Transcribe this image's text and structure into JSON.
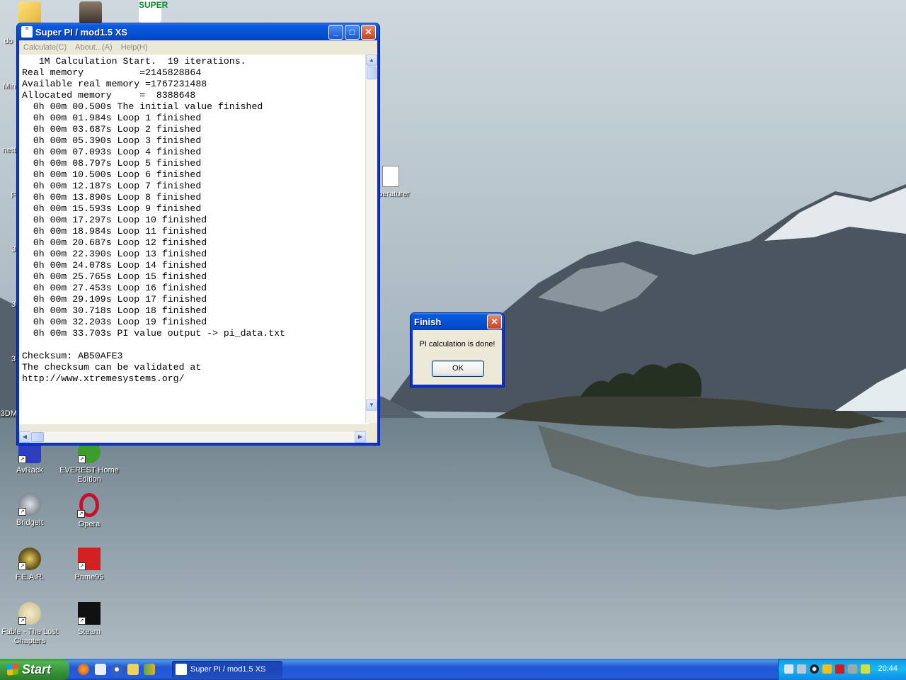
{
  "desktop": {
    "icons": [
      {
        "label": "AvRack",
        "color": "#2b3fbf"
      },
      {
        "label": "EVEREST Home Edition",
        "color": "#3e9c2a"
      },
      {
        "label": "BridgeIt",
        "color": "#5a6270"
      },
      {
        "label": "Opera",
        "color": "#c8102e"
      },
      {
        "label": "F.E.A.R.",
        "color": "#6b5a1e"
      },
      {
        "label": "Prime95",
        "color": "#d42020"
      },
      {
        "label": "Fable - The Lost Chapters",
        "color": "#c7b78a"
      },
      {
        "label": "Steam",
        "color": "#111111"
      },
      {
        "label": "mperaturer",
        "color": "#e8e8e8"
      }
    ],
    "partial_labels": [
      "do",
      "Min",
      "nett",
      "F",
      "3",
      "3",
      "3",
      "3DM"
    ],
    "top_icon_text": "SUPER"
  },
  "superpi_window": {
    "title": "Super PI / mod1.5 XS",
    "menu": [
      "Calculate(C)",
      "About...(A)",
      "Help(H)"
    ],
    "output_lines": [
      "   1M Calculation Start.  19 iterations.",
      "Real memory          =2145828864",
      "Available real memory =1767231488",
      "Allocated memory     =  8388648",
      "  0h 00m 00.500s The initial value finished",
      "  0h 00m 01.984s Loop 1 finished",
      "  0h 00m 03.687s Loop 2 finished",
      "  0h 00m 05.390s Loop 3 finished",
      "  0h 00m 07.093s Loop 4 finished",
      "  0h 00m 08.797s Loop 5 finished",
      "  0h 00m 10.500s Loop 6 finished",
      "  0h 00m 12.187s Loop 7 finished",
      "  0h 00m 13.890s Loop 8 finished",
      "  0h 00m 15.593s Loop 9 finished",
      "  0h 00m 17.297s Loop 10 finished",
      "  0h 00m 18.984s Loop 11 finished",
      "  0h 00m 20.687s Loop 12 finished",
      "  0h 00m 22.390s Loop 13 finished",
      "  0h 00m 24.078s Loop 14 finished",
      "  0h 00m 25.765s Loop 15 finished",
      "  0h 00m 27.453s Loop 16 finished",
      "  0h 00m 29.109s Loop 17 finished",
      "  0h 00m 30.718s Loop 18 finished",
      "  0h 00m 32.203s Loop 19 finished",
      "  0h 00m 33.703s PI value output -> pi_data.txt",
      "",
      "Checksum: AB50AFE3",
      "The checksum can be validated at",
      "http://www.xtremesystems.org/"
    ]
  },
  "finish_dialog": {
    "title": "Finish",
    "message": "PI calculation is done!",
    "ok_label": "OK"
  },
  "taskbar": {
    "start_label": "Start",
    "task_item": "Super PI / mod1.5 XS",
    "clock": "20:44",
    "quick_launch_icons": [
      "firefox-icon",
      "document-icon",
      "media-player-icon",
      "folder-icon",
      "people-icon"
    ],
    "tray_icons": [
      "network-icon",
      "volume-icon",
      "target-icon",
      "shield-icon",
      "antivirus-icon",
      "tool-icon",
      "battery-icon"
    ]
  }
}
